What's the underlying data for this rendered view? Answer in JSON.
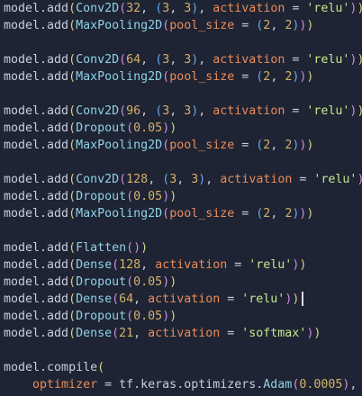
{
  "colors": {
    "background": "#1e2433",
    "plain": "#c9ced8",
    "func": "#8fd1e8",
    "number": "#d7b06a",
    "param": "#e98b5a",
    "string": "#c3e88d",
    "paren_l1": "#d6d08a",
    "paren_l2": "#cf8be0",
    "paren_l3": "#6aa6ee",
    "keyword": "#c9ced8"
  },
  "lines": [
    [
      {
        "t": "model",
        "c": "plain"
      },
      {
        "t": ".",
        "c": "plain"
      },
      {
        "t": "add",
        "c": "plain"
      },
      {
        "t": "(",
        "c": "paren_l1"
      },
      {
        "t": "Conv2D",
        "c": "func"
      },
      {
        "t": "(",
        "c": "paren_l2"
      },
      {
        "t": "32",
        "c": "number"
      },
      {
        "t": ", ",
        "c": "plain"
      },
      {
        "t": "(",
        "c": "paren_l3"
      },
      {
        "t": "3",
        "c": "number"
      },
      {
        "t": ", ",
        "c": "plain"
      },
      {
        "t": "3",
        "c": "number"
      },
      {
        "t": ")",
        "c": "paren_l3"
      },
      {
        "t": ", ",
        "c": "plain"
      },
      {
        "t": "activation",
        "c": "param"
      },
      {
        "t": " = ",
        "c": "plain"
      },
      {
        "t": "'relu'",
        "c": "string"
      },
      {
        "t": ")",
        "c": "paren_l2"
      },
      {
        "t": ")",
        "c": "paren_l1"
      }
    ],
    [
      {
        "t": "model",
        "c": "plain"
      },
      {
        "t": ".",
        "c": "plain"
      },
      {
        "t": "add",
        "c": "plain"
      },
      {
        "t": "(",
        "c": "paren_l1"
      },
      {
        "t": "MaxPooling2D",
        "c": "func"
      },
      {
        "t": "(",
        "c": "paren_l2"
      },
      {
        "t": "pool_size",
        "c": "param"
      },
      {
        "t": " = ",
        "c": "plain"
      },
      {
        "t": "(",
        "c": "paren_l3"
      },
      {
        "t": "2",
        "c": "number"
      },
      {
        "t": ", ",
        "c": "plain"
      },
      {
        "t": "2",
        "c": "number"
      },
      {
        "t": ")",
        "c": "paren_l3"
      },
      {
        "t": ")",
        "c": "paren_l2"
      },
      {
        "t": ")",
        "c": "paren_l1"
      }
    ],
    [],
    [
      {
        "t": "model",
        "c": "plain"
      },
      {
        "t": ".",
        "c": "plain"
      },
      {
        "t": "add",
        "c": "plain"
      },
      {
        "t": "(",
        "c": "paren_l1"
      },
      {
        "t": "Conv2D",
        "c": "func"
      },
      {
        "t": "(",
        "c": "paren_l2"
      },
      {
        "t": "64",
        "c": "number"
      },
      {
        "t": ", ",
        "c": "plain"
      },
      {
        "t": "(",
        "c": "paren_l3"
      },
      {
        "t": "3",
        "c": "number"
      },
      {
        "t": ", ",
        "c": "plain"
      },
      {
        "t": "3",
        "c": "number"
      },
      {
        "t": ")",
        "c": "paren_l3"
      },
      {
        "t": ", ",
        "c": "plain"
      },
      {
        "t": "activation",
        "c": "param"
      },
      {
        "t": " = ",
        "c": "plain"
      },
      {
        "t": "'relu'",
        "c": "string"
      },
      {
        "t": ")",
        "c": "paren_l2"
      },
      {
        "t": ")",
        "c": "paren_l1"
      }
    ],
    [
      {
        "t": "model",
        "c": "plain"
      },
      {
        "t": ".",
        "c": "plain"
      },
      {
        "t": "add",
        "c": "plain"
      },
      {
        "t": "(",
        "c": "paren_l1"
      },
      {
        "t": "MaxPooling2D",
        "c": "func"
      },
      {
        "t": "(",
        "c": "paren_l2"
      },
      {
        "t": "pool_size",
        "c": "param"
      },
      {
        "t": " = ",
        "c": "plain"
      },
      {
        "t": "(",
        "c": "paren_l3"
      },
      {
        "t": "2",
        "c": "number"
      },
      {
        "t": ", ",
        "c": "plain"
      },
      {
        "t": "2",
        "c": "number"
      },
      {
        "t": ")",
        "c": "paren_l3"
      },
      {
        "t": ")",
        "c": "paren_l2"
      },
      {
        "t": ")",
        "c": "paren_l1"
      }
    ],
    [],
    [
      {
        "t": "model",
        "c": "plain"
      },
      {
        "t": ".",
        "c": "plain"
      },
      {
        "t": "add",
        "c": "plain"
      },
      {
        "t": "(",
        "c": "paren_l1"
      },
      {
        "t": "Conv2D",
        "c": "func"
      },
      {
        "t": "(",
        "c": "paren_l2"
      },
      {
        "t": "96",
        "c": "number"
      },
      {
        "t": ", ",
        "c": "plain"
      },
      {
        "t": "(",
        "c": "paren_l3"
      },
      {
        "t": "3",
        "c": "number"
      },
      {
        "t": ", ",
        "c": "plain"
      },
      {
        "t": "3",
        "c": "number"
      },
      {
        "t": ")",
        "c": "paren_l3"
      },
      {
        "t": ", ",
        "c": "plain"
      },
      {
        "t": "activation",
        "c": "param"
      },
      {
        "t": " = ",
        "c": "plain"
      },
      {
        "t": "'relu'",
        "c": "string"
      },
      {
        "t": ")",
        "c": "paren_l2"
      },
      {
        "t": ")",
        "c": "paren_l1"
      }
    ],
    [
      {
        "t": "model",
        "c": "plain"
      },
      {
        "t": ".",
        "c": "plain"
      },
      {
        "t": "add",
        "c": "plain"
      },
      {
        "t": "(",
        "c": "paren_l1"
      },
      {
        "t": "Dropout",
        "c": "func"
      },
      {
        "t": "(",
        "c": "paren_l2"
      },
      {
        "t": "0.05",
        "c": "number"
      },
      {
        "t": ")",
        "c": "paren_l2"
      },
      {
        "t": ")",
        "c": "paren_l1"
      }
    ],
    [
      {
        "t": "model",
        "c": "plain"
      },
      {
        "t": ".",
        "c": "plain"
      },
      {
        "t": "add",
        "c": "plain"
      },
      {
        "t": "(",
        "c": "paren_l1"
      },
      {
        "t": "MaxPooling2D",
        "c": "func"
      },
      {
        "t": "(",
        "c": "paren_l2"
      },
      {
        "t": "pool_size",
        "c": "param"
      },
      {
        "t": " = ",
        "c": "plain"
      },
      {
        "t": "(",
        "c": "paren_l3"
      },
      {
        "t": "2",
        "c": "number"
      },
      {
        "t": ", ",
        "c": "plain"
      },
      {
        "t": "2",
        "c": "number"
      },
      {
        "t": ")",
        "c": "paren_l3"
      },
      {
        "t": ")",
        "c": "paren_l2"
      },
      {
        "t": ")",
        "c": "paren_l1"
      }
    ],
    [],
    [
      {
        "t": "model",
        "c": "plain"
      },
      {
        "t": ".",
        "c": "plain"
      },
      {
        "t": "add",
        "c": "plain"
      },
      {
        "t": "(",
        "c": "paren_l1"
      },
      {
        "t": "Conv2D",
        "c": "func"
      },
      {
        "t": "(",
        "c": "paren_l2"
      },
      {
        "t": "128",
        "c": "number"
      },
      {
        "t": ", ",
        "c": "plain"
      },
      {
        "t": "(",
        "c": "paren_l3"
      },
      {
        "t": "3",
        "c": "number"
      },
      {
        "t": ", ",
        "c": "plain"
      },
      {
        "t": "3",
        "c": "number"
      },
      {
        "t": ")",
        "c": "paren_l3"
      },
      {
        "t": ", ",
        "c": "plain"
      },
      {
        "t": "activation",
        "c": "param"
      },
      {
        "t": " = ",
        "c": "plain"
      },
      {
        "t": "'relu'",
        "c": "string"
      },
      {
        "t": ")",
        "c": "paren_l2"
      },
      {
        "t": ")",
        "c": "paren_l1"
      }
    ],
    [
      {
        "t": "model",
        "c": "plain"
      },
      {
        "t": ".",
        "c": "plain"
      },
      {
        "t": "add",
        "c": "plain"
      },
      {
        "t": "(",
        "c": "paren_l1"
      },
      {
        "t": "Dropout",
        "c": "func"
      },
      {
        "t": "(",
        "c": "paren_l2"
      },
      {
        "t": "0.05",
        "c": "number"
      },
      {
        "t": ")",
        "c": "paren_l2"
      },
      {
        "t": ")",
        "c": "paren_l1"
      }
    ],
    [
      {
        "t": "model",
        "c": "plain"
      },
      {
        "t": ".",
        "c": "plain"
      },
      {
        "t": "add",
        "c": "plain"
      },
      {
        "t": "(",
        "c": "paren_l1"
      },
      {
        "t": "MaxPooling2D",
        "c": "func"
      },
      {
        "t": "(",
        "c": "paren_l2"
      },
      {
        "t": "pool_size",
        "c": "param"
      },
      {
        "t": " = ",
        "c": "plain"
      },
      {
        "t": "(",
        "c": "paren_l3"
      },
      {
        "t": "2",
        "c": "number"
      },
      {
        "t": ", ",
        "c": "plain"
      },
      {
        "t": "2",
        "c": "number"
      },
      {
        "t": ")",
        "c": "paren_l3"
      },
      {
        "t": ")",
        "c": "paren_l2"
      },
      {
        "t": ")",
        "c": "paren_l1"
      }
    ],
    [],
    [
      {
        "t": "model",
        "c": "plain"
      },
      {
        "t": ".",
        "c": "plain"
      },
      {
        "t": "add",
        "c": "plain"
      },
      {
        "t": "(",
        "c": "paren_l1"
      },
      {
        "t": "Flatten",
        "c": "func"
      },
      {
        "t": "(",
        "c": "paren_l2"
      },
      {
        "t": ")",
        "c": "paren_l2"
      },
      {
        "t": ")",
        "c": "paren_l1"
      }
    ],
    [
      {
        "t": "model",
        "c": "plain"
      },
      {
        "t": ".",
        "c": "plain"
      },
      {
        "t": "add",
        "c": "plain"
      },
      {
        "t": "(",
        "c": "paren_l1"
      },
      {
        "t": "Dense",
        "c": "func"
      },
      {
        "t": "(",
        "c": "paren_l2"
      },
      {
        "t": "128",
        "c": "number"
      },
      {
        "t": ", ",
        "c": "plain"
      },
      {
        "t": "activation",
        "c": "param"
      },
      {
        "t": " = ",
        "c": "plain"
      },
      {
        "t": "'relu'",
        "c": "string"
      },
      {
        "t": ")",
        "c": "paren_l2"
      },
      {
        "t": ")",
        "c": "paren_l1"
      }
    ],
    [
      {
        "t": "model",
        "c": "plain"
      },
      {
        "t": ".",
        "c": "plain"
      },
      {
        "t": "add",
        "c": "plain"
      },
      {
        "t": "(",
        "c": "paren_l1"
      },
      {
        "t": "Dropout",
        "c": "func"
      },
      {
        "t": "(",
        "c": "paren_l2"
      },
      {
        "t": "0.05",
        "c": "number"
      },
      {
        "t": ")",
        "c": "paren_l2"
      },
      {
        "t": ")",
        "c": "paren_l1"
      }
    ],
    [
      {
        "t": "model",
        "c": "plain"
      },
      {
        "t": ".",
        "c": "plain"
      },
      {
        "t": "add",
        "c": "plain"
      },
      {
        "t": "(",
        "c": "paren_l1"
      },
      {
        "t": "Dense",
        "c": "func"
      },
      {
        "t": "(",
        "c": "paren_l2"
      },
      {
        "t": "64",
        "c": "number"
      },
      {
        "t": ", ",
        "c": "plain"
      },
      {
        "t": "activation",
        "c": "param"
      },
      {
        "t": " = ",
        "c": "plain"
      },
      {
        "t": "'relu'",
        "c": "string"
      },
      {
        "t": ")",
        "c": "paren_l2"
      },
      {
        "t": ")",
        "c": "paren_l1"
      }
    ],
    [
      {
        "t": "model",
        "c": "plain"
      },
      {
        "t": ".",
        "c": "plain"
      },
      {
        "t": "add",
        "c": "plain"
      },
      {
        "t": "(",
        "c": "paren_l1"
      },
      {
        "t": "Dropout",
        "c": "func"
      },
      {
        "t": "(",
        "c": "paren_l2"
      },
      {
        "t": "0.05",
        "c": "number"
      },
      {
        "t": ")",
        "c": "paren_l2"
      },
      {
        "t": ")",
        "c": "paren_l1"
      }
    ],
    [
      {
        "t": "model",
        "c": "plain"
      },
      {
        "t": ".",
        "c": "plain"
      },
      {
        "t": "add",
        "c": "plain"
      },
      {
        "t": "(",
        "c": "paren_l1"
      },
      {
        "t": "Dense",
        "c": "func"
      },
      {
        "t": "(",
        "c": "paren_l2"
      },
      {
        "t": "21",
        "c": "number"
      },
      {
        "t": ", ",
        "c": "plain"
      },
      {
        "t": "activation",
        "c": "param"
      },
      {
        "t": " = ",
        "c": "plain"
      },
      {
        "t": "'softmax'",
        "c": "string"
      },
      {
        "t": ")",
        "c": "paren_l2"
      },
      {
        "t": ")",
        "c": "paren_l1"
      }
    ],
    [],
    [
      {
        "t": "model",
        "c": "plain"
      },
      {
        "t": ".",
        "c": "plain"
      },
      {
        "t": "compile",
        "c": "plain"
      },
      {
        "t": "(",
        "c": "paren_l1"
      }
    ],
    [
      {
        "t": "    ",
        "c": "plain"
      },
      {
        "t": "optimizer",
        "c": "param"
      },
      {
        "t": " = ",
        "c": "plain"
      },
      {
        "t": "tf",
        "c": "plain"
      },
      {
        "t": ".",
        "c": "plain"
      },
      {
        "t": "keras",
        "c": "plain"
      },
      {
        "t": ".",
        "c": "plain"
      },
      {
        "t": "optimizers",
        "c": "plain"
      },
      {
        "t": ".",
        "c": "plain"
      },
      {
        "t": "Adam",
        "c": "func"
      },
      {
        "t": "(",
        "c": "paren_l2"
      },
      {
        "t": "0.0005",
        "c": "number"
      },
      {
        "t": ")",
        "c": "paren_l2"
      },
      {
        "t": ",",
        "c": "plain"
      }
    ]
  ]
}
